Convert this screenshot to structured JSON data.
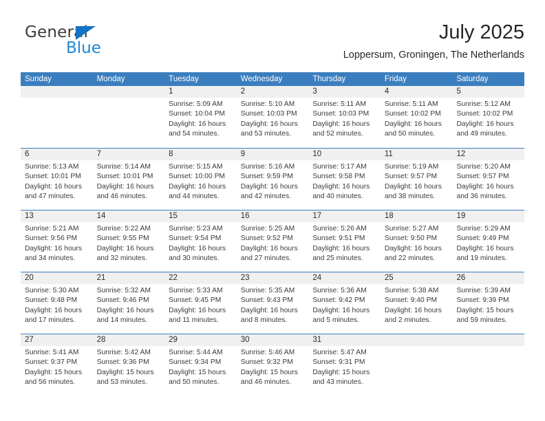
{
  "brand": {
    "name_part1": "General",
    "name_part2": "Blue",
    "triangle_color": "#1373c4",
    "blue_color": "#1e87d6"
  },
  "header": {
    "title": "July 2025",
    "subtitle": "Loppersum, Groningen, The Netherlands"
  },
  "theme": {
    "header_bg": "#3b7ebf",
    "header_text": "#ffffff",
    "daynum_bg": "#f0f0f0",
    "row_border": "#3b7ebf"
  },
  "weekdays": [
    "Sunday",
    "Monday",
    "Tuesday",
    "Wednesday",
    "Thursday",
    "Friday",
    "Saturday"
  ],
  "weeks": [
    [
      {
        "day": "",
        "lines": [
          "",
          "",
          "",
          ""
        ]
      },
      {
        "day": "",
        "lines": [
          "",
          "",
          "",
          ""
        ]
      },
      {
        "day": "1",
        "lines": [
          "Sunrise: 5:09 AM",
          "Sunset: 10:04 PM",
          "Daylight: 16 hours",
          "and 54 minutes."
        ]
      },
      {
        "day": "2",
        "lines": [
          "Sunrise: 5:10 AM",
          "Sunset: 10:03 PM",
          "Daylight: 16 hours",
          "and 53 minutes."
        ]
      },
      {
        "day": "3",
        "lines": [
          "Sunrise: 5:11 AM",
          "Sunset: 10:03 PM",
          "Daylight: 16 hours",
          "and 52 minutes."
        ]
      },
      {
        "day": "4",
        "lines": [
          "Sunrise: 5:11 AM",
          "Sunset: 10:02 PM",
          "Daylight: 16 hours",
          "and 50 minutes."
        ]
      },
      {
        "day": "5",
        "lines": [
          "Sunrise: 5:12 AM",
          "Sunset: 10:02 PM",
          "Daylight: 16 hours",
          "and 49 minutes."
        ]
      }
    ],
    [
      {
        "day": "6",
        "lines": [
          "Sunrise: 5:13 AM",
          "Sunset: 10:01 PM",
          "Daylight: 16 hours",
          "and 47 minutes."
        ]
      },
      {
        "day": "7",
        "lines": [
          "Sunrise: 5:14 AM",
          "Sunset: 10:01 PM",
          "Daylight: 16 hours",
          "and 46 minutes."
        ]
      },
      {
        "day": "8",
        "lines": [
          "Sunrise: 5:15 AM",
          "Sunset: 10:00 PM",
          "Daylight: 16 hours",
          "and 44 minutes."
        ]
      },
      {
        "day": "9",
        "lines": [
          "Sunrise: 5:16 AM",
          "Sunset: 9:59 PM",
          "Daylight: 16 hours",
          "and 42 minutes."
        ]
      },
      {
        "day": "10",
        "lines": [
          "Sunrise: 5:17 AM",
          "Sunset: 9:58 PM",
          "Daylight: 16 hours",
          "and 40 minutes."
        ]
      },
      {
        "day": "11",
        "lines": [
          "Sunrise: 5:19 AM",
          "Sunset: 9:57 PM",
          "Daylight: 16 hours",
          "and 38 minutes."
        ]
      },
      {
        "day": "12",
        "lines": [
          "Sunrise: 5:20 AM",
          "Sunset: 9:57 PM",
          "Daylight: 16 hours",
          "and 36 minutes."
        ]
      }
    ],
    [
      {
        "day": "13",
        "lines": [
          "Sunrise: 5:21 AM",
          "Sunset: 9:56 PM",
          "Daylight: 16 hours",
          "and 34 minutes."
        ]
      },
      {
        "day": "14",
        "lines": [
          "Sunrise: 5:22 AM",
          "Sunset: 9:55 PM",
          "Daylight: 16 hours",
          "and 32 minutes."
        ]
      },
      {
        "day": "15",
        "lines": [
          "Sunrise: 5:23 AM",
          "Sunset: 9:54 PM",
          "Daylight: 16 hours",
          "and 30 minutes."
        ]
      },
      {
        "day": "16",
        "lines": [
          "Sunrise: 5:25 AM",
          "Sunset: 9:52 PM",
          "Daylight: 16 hours",
          "and 27 minutes."
        ]
      },
      {
        "day": "17",
        "lines": [
          "Sunrise: 5:26 AM",
          "Sunset: 9:51 PM",
          "Daylight: 16 hours",
          "and 25 minutes."
        ]
      },
      {
        "day": "18",
        "lines": [
          "Sunrise: 5:27 AM",
          "Sunset: 9:50 PM",
          "Daylight: 16 hours",
          "and 22 minutes."
        ]
      },
      {
        "day": "19",
        "lines": [
          "Sunrise: 5:29 AM",
          "Sunset: 9:49 PM",
          "Daylight: 16 hours",
          "and 19 minutes."
        ]
      }
    ],
    [
      {
        "day": "20",
        "lines": [
          "Sunrise: 5:30 AM",
          "Sunset: 9:48 PM",
          "Daylight: 16 hours",
          "and 17 minutes."
        ]
      },
      {
        "day": "21",
        "lines": [
          "Sunrise: 5:32 AM",
          "Sunset: 9:46 PM",
          "Daylight: 16 hours",
          "and 14 minutes."
        ]
      },
      {
        "day": "22",
        "lines": [
          "Sunrise: 5:33 AM",
          "Sunset: 9:45 PM",
          "Daylight: 16 hours",
          "and 11 minutes."
        ]
      },
      {
        "day": "23",
        "lines": [
          "Sunrise: 5:35 AM",
          "Sunset: 9:43 PM",
          "Daylight: 16 hours",
          "and 8 minutes."
        ]
      },
      {
        "day": "24",
        "lines": [
          "Sunrise: 5:36 AM",
          "Sunset: 9:42 PM",
          "Daylight: 16 hours",
          "and 5 minutes."
        ]
      },
      {
        "day": "25",
        "lines": [
          "Sunrise: 5:38 AM",
          "Sunset: 9:40 PM",
          "Daylight: 16 hours",
          "and 2 minutes."
        ]
      },
      {
        "day": "26",
        "lines": [
          "Sunrise: 5:39 AM",
          "Sunset: 9:39 PM",
          "Daylight: 15 hours",
          "and 59 minutes."
        ]
      }
    ],
    [
      {
        "day": "27",
        "lines": [
          "Sunrise: 5:41 AM",
          "Sunset: 9:37 PM",
          "Daylight: 15 hours",
          "and 56 minutes."
        ]
      },
      {
        "day": "28",
        "lines": [
          "Sunrise: 5:42 AM",
          "Sunset: 9:36 PM",
          "Daylight: 15 hours",
          "and 53 minutes."
        ]
      },
      {
        "day": "29",
        "lines": [
          "Sunrise: 5:44 AM",
          "Sunset: 9:34 PM",
          "Daylight: 15 hours",
          "and 50 minutes."
        ]
      },
      {
        "day": "30",
        "lines": [
          "Sunrise: 5:46 AM",
          "Sunset: 9:32 PM",
          "Daylight: 15 hours",
          "and 46 minutes."
        ]
      },
      {
        "day": "31",
        "lines": [
          "Sunrise: 5:47 AM",
          "Sunset: 9:31 PM",
          "Daylight: 15 hours",
          "and 43 minutes."
        ]
      },
      {
        "day": "",
        "lines": [
          "",
          "",
          "",
          ""
        ]
      },
      {
        "day": "",
        "lines": [
          "",
          "",
          "",
          ""
        ]
      }
    ]
  ]
}
